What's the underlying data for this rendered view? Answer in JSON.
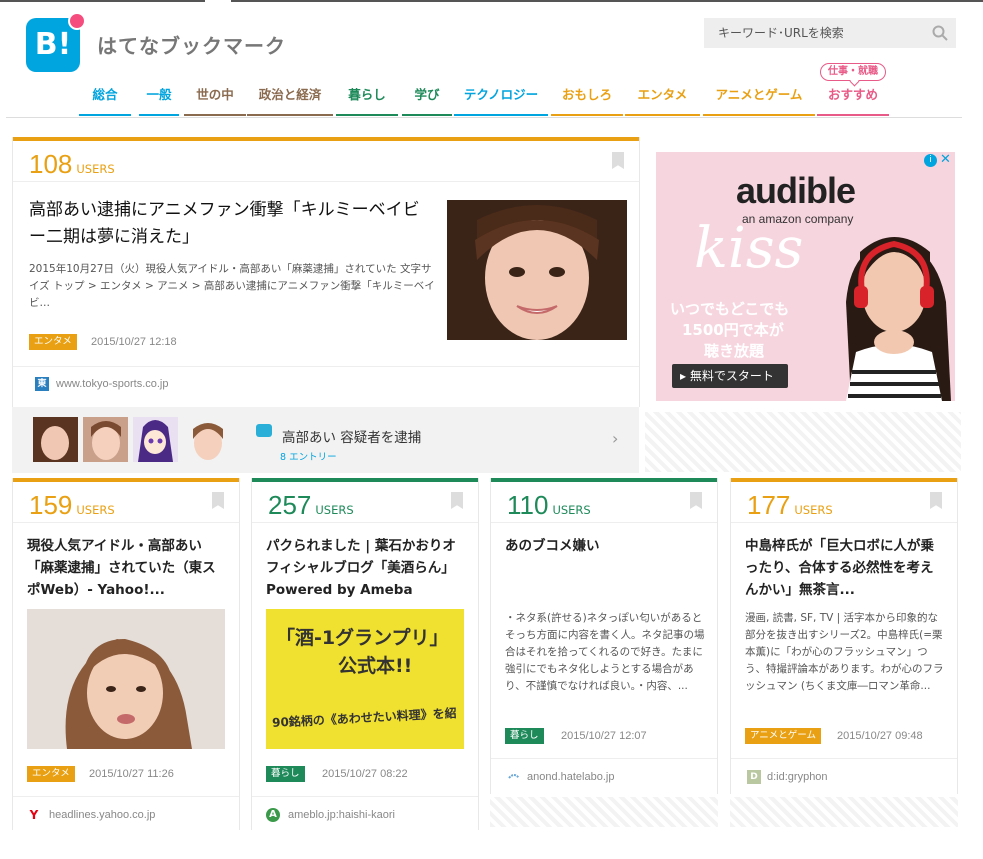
{
  "header": {
    "logo_text": "B!",
    "site_title": "はてなブックマーク",
    "search_placeholder": "キーワード･URLを検索"
  },
  "nav": {
    "items": [
      {
        "label": "総合",
        "color": "#00a4de"
      },
      {
        "label": "一般",
        "color": "#00a4de"
      },
      {
        "label": "世の中",
        "color": "#8b6b4f"
      },
      {
        "label": "政治と経済",
        "color": "#8b6b4f"
      },
      {
        "label": "暮らし",
        "color": "#1e8a5a"
      },
      {
        "label": "学び",
        "color": "#1e8a5a"
      },
      {
        "label": "テクノロジー",
        "color": "#00a4de"
      },
      {
        "label": "おもしろ",
        "color": "#e9a012"
      },
      {
        "label": "エンタメ",
        "color": "#e9a012"
      },
      {
        "label": "アニメとゲーム",
        "color": "#e9a012"
      },
      {
        "label": "おすすめ",
        "color": "#e85b88"
      }
    ],
    "pill": "仕事・就職"
  },
  "featured": {
    "users_count": "108",
    "users_label": "USERS",
    "title": "高部あい逮捕にアニメファン衝撃「キルミーベイビー二期は夢に消えた」",
    "description": "2015年10月27日（火）現役人気アイドル・高部あい「麻薬逮捕」されていた 文字サイズ トップ > エンタメ > アニメ > 高部あい逮捕にアニメファン衝撃「キルミーベイビ…",
    "category": "エンタメ",
    "date": "2015/10/27 12:18",
    "domain": "www.tokyo-sports.co.jp",
    "favicon": "東",
    "color": "#e9a012"
  },
  "related": {
    "title": "高部あい 容疑者を逮捕",
    "count": "8 エントリー"
  },
  "ad": {
    "brand": "audible",
    "brand_sub": "an amazon company",
    "script": "kiss",
    "line1": "いつでもどこでも",
    "line2": "1500円で本が",
    "line3": "聴き放題",
    "cta": "▸ 無料でスタート"
  },
  "cards": [
    {
      "users_count": "159",
      "users_label": "USERS",
      "title": "現役人気アイドル・高部あい「麻薬逮捕」されていた（東スポWeb）- Yahoo!...",
      "description": "",
      "category": "エンタメ",
      "date": "2015/10/27 11:26",
      "domain": "headlines.yahoo.co.jp",
      "favicon": "Y",
      "color": "#e9a012",
      "tag_color": "#e9a012"
    },
    {
      "users_count": "257",
      "users_label": "USERS",
      "title": "パクられました | 葉石かおりオフィシャルブログ「美酒らん」Powered by Ameba",
      "description": "",
      "category": "暮らし",
      "date": "2015/10/27 08:22",
      "domain": "ameblo.jp:haishi-kaori",
      "favicon": "A",
      "color": "#1e8a5a",
      "tag_color": "#1e8a5a",
      "photo_text1": "「酒-1グランプリ」",
      "photo_text2": "公式本!!",
      "photo_text3": "90銘柄の《あわせたい料理》を紹"
    },
    {
      "users_count": "110",
      "users_label": "USERS",
      "title": "あのブコメ嫌い",
      "description": "・ネタ系(許せる)ネタっぽい匂いがあるとそっち方面に内容を書く人。ネタ記事の場合はそれを拾ってくれるので好き。たまに強引にでもネタ化しようとする場合があり、不謹慎でなければ良い。・内容、...",
      "category": "暮らし",
      "date": "2015/10/27 12:07",
      "domain": "anond.hatelabo.jp",
      "favicon": "",
      "color": "#1e8a5a",
      "tag_color": "#1e8a5a"
    },
    {
      "users_count": "177",
      "users_label": "USERS",
      "title": "中島梓氏が「巨大ロボに人が乗ったり、合体する必然性を考えんかい」無茶言...",
      "description": "漫画, 読書, SF, TV | 活字本から印象的な部分を抜き出すシリーズ2。中島梓氏(=栗本薫)に「わが心のフラッシュマン」つう、特撮評論本があります。わが心のフラッシュマン (ちくま文庫―ロマン革命...",
      "category": "アニメとゲーム",
      "date": "2015/10/27 09:48",
      "domain": "d:id:gryphon",
      "favicon": "D",
      "color": "#e9a012",
      "tag_color": "#e9a012"
    }
  ]
}
